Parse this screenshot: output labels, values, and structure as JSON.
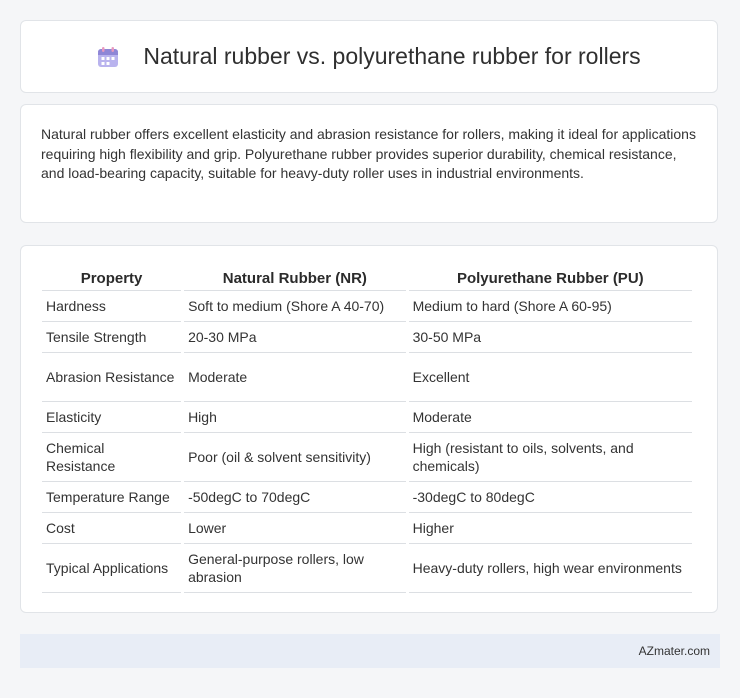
{
  "header": {
    "title": "Natural rubber vs. polyurethane rubber for rollers",
    "icon": "calendar-icon"
  },
  "summary": {
    "text": "Natural rubber offers excellent elasticity and abrasion resistance for rollers, making it ideal for applications requiring high flexibility and grip. Polyurethane rubber provides superior durability, chemical resistance, and load-bearing capacity, suitable for heavy-duty roller uses in industrial environments."
  },
  "table": {
    "headers": [
      "Property",
      "Natural Rubber (NR)",
      "Polyurethane Rubber (PU)"
    ],
    "rows": [
      [
        "Hardness",
        "Soft to medium (Shore A 40-70)",
        "Medium to hard (Shore A 60-95)"
      ],
      [
        "Tensile Strength",
        "20-30 MPa",
        "30-50 MPa"
      ],
      [
        "Abrasion Resistance",
        "Moderate",
        "Excellent"
      ],
      [
        "Elasticity",
        "High",
        "Moderate"
      ],
      [
        "Chemical Resistance",
        "Poor (oil & solvent sensitivity)",
        "High (resistant to oils, solvents, and chemicals)"
      ],
      [
        "Temperature Range",
        "-50degC to 70degC",
        "-30degC to 80degC"
      ],
      [
        "Cost",
        "Lower",
        "Higher"
      ],
      [
        "Typical Applications",
        "General-purpose rollers, low abrasion",
        "Heavy-duty rollers, high wear environments"
      ]
    ]
  },
  "footer": {
    "brand": "AZmater.com"
  },
  "colors": {
    "background": "#f5f6f8",
    "footer_bg": "#e8edf6",
    "icon_purple": "#8e86d6",
    "icon_pink": "#e89ac0"
  }
}
